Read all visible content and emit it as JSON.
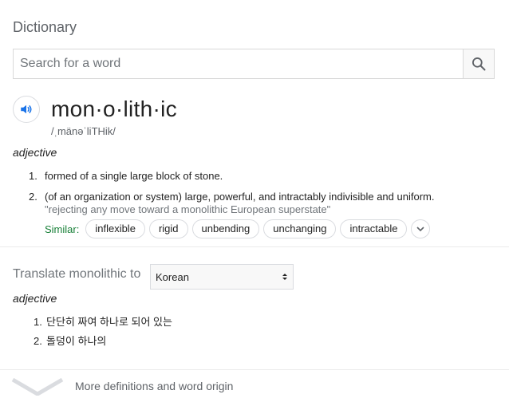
{
  "title": "Dictionary",
  "search": {
    "placeholder": "Search for a word",
    "value": "",
    "icon": "search-icon"
  },
  "entry": {
    "headword": "mon·o·lith·ic",
    "phonetic": "/ˌmänəˈliTHik/",
    "part_of_speech": "adjective",
    "definitions": [
      {
        "num": "1.",
        "text": "formed of a single large block of stone."
      },
      {
        "num": "2.",
        "text": "(of an organization or system) large, powerful, and intractably indivisible and uniform.",
        "example": "\"rejecting any move toward a monolithic European superstate\""
      }
    ],
    "similar_label": "Similar:",
    "similar": [
      "inflexible",
      "rigid",
      "unbending",
      "unchanging",
      "intractable"
    ]
  },
  "translate": {
    "label": "Translate monolithic to",
    "selected_language": "Korean",
    "part_of_speech": "adjective",
    "translations": [
      {
        "num": "1.",
        "text": "단단히 짜여 하나로 되어 있는"
      },
      {
        "num": "2.",
        "text": "돌덩이 하나의"
      }
    ]
  },
  "footer": {
    "more_label": "More definitions and word origin"
  },
  "colors": {
    "accent_blue": "#1a73e8",
    "similar_green": "#188038",
    "muted": "#70757a"
  }
}
